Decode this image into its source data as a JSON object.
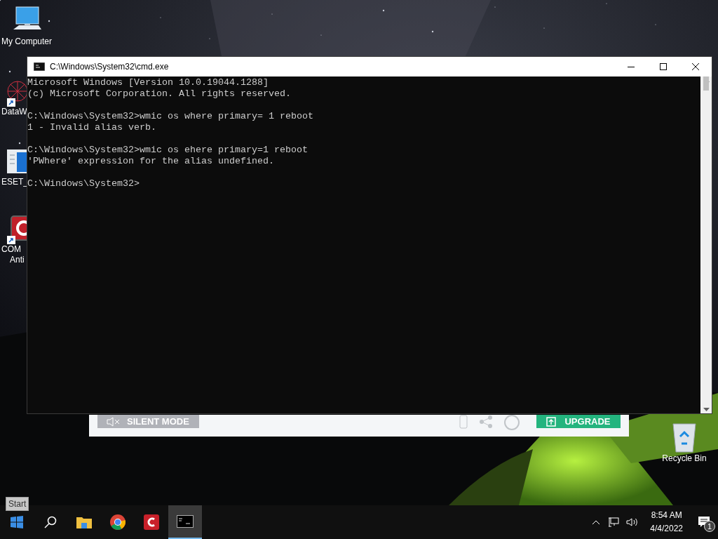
{
  "desktop_icons": [
    {
      "kind": "computer",
      "label": "My Computer",
      "shortcut": false
    },
    {
      "kind": "web",
      "label": "DataW",
      "shortcut": true
    },
    {
      "kind": "document",
      "label": "ESET_",
      "shortcut": false
    },
    {
      "kind": "antivirus",
      "label": "COM",
      "label_line_2": "Anti",
      "shortcut": true
    },
    {
      "kind": "recycle",
      "label": "Recycle Bin",
      "shortcut": false
    }
  ],
  "background_app": {
    "silent_mode_button": "SILENT MODE",
    "upgrade_button": "UPGRADE"
  },
  "console_window": {
    "title": "C:\\Windows\\System32\\cmd.exe",
    "blocks": [
      [
        "Microsoft Windows [Version 10.0.19044.1288]",
        "(c) Microsoft Corporation. All rights reserved."
      ],
      [
        "C:\\Windows\\System32>wmic os where primary= 1 reboot",
        "1 - Invalid alias verb."
      ],
      [
        "C:\\Windows\\System32>wmic os ehere primary=1 reboot",
        "'PWhere' expression for the alias undefined."
      ],
      [
        "C:\\Windows\\System32>"
      ]
    ]
  },
  "tooltip": "Start",
  "taskbar": {
    "apps": [
      {
        "kind": "start",
        "selected": false
      },
      {
        "kind": "search",
        "selected": false
      },
      {
        "kind": "folder",
        "selected": false
      },
      {
        "kind": "browser",
        "selected": false
      },
      {
        "kind": "antivirus",
        "selected": false
      },
      {
        "kind": "console",
        "selected": true
      }
    ],
    "time": "8:54 AM",
    "date": "4/4/2022",
    "notification_count": "1"
  }
}
